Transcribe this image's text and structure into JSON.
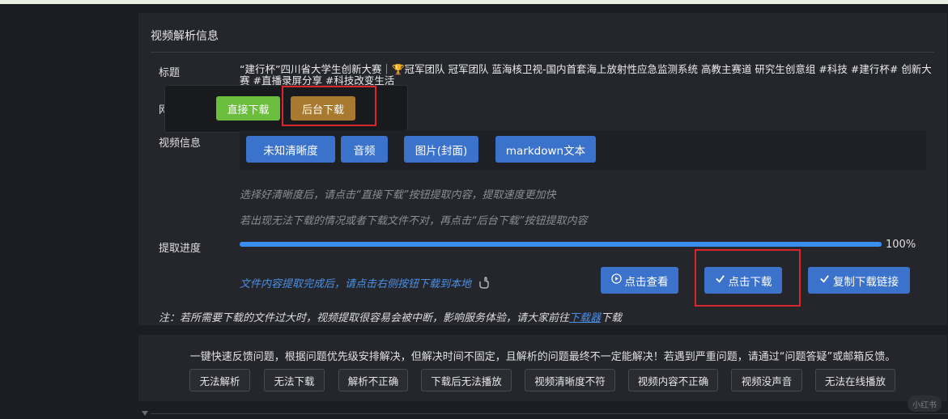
{
  "section_title": "视频解析信息",
  "fields": {
    "title_label": "标题",
    "title_value": "“建行杯”四川省大学生创新大赛｜🏆冠军团队 冠军团队 蓝海核卫视-国内首套海上放射性应急监测系统 高教主赛道 研究生创意组 #科技 #建行杯# 创新大赛 #直播录屏分享 #科技改变生活",
    "hidden_label_partial": "网",
    "video_info_label": "视频信息",
    "progress_label": "提取进度"
  },
  "popup": {
    "direct_download": "直接下载",
    "background_download": "后台下载"
  },
  "video_options": [
    "未知清晰度",
    "音频",
    "图片(封面)",
    "markdown文本"
  ],
  "hints": [
    "选择好清晰度后，请点击“直接下载”按钮提取内容，提取速度更加快",
    "若出现无法下载的情况或者下载文件不对，再点击“后台下载”按钮提取内容"
  ],
  "progress": {
    "value": 100,
    "text": "100%"
  },
  "complete_note": "文件内容提取完成后，请点击右侧按钮下载到本地",
  "actions": {
    "view": "点击查看",
    "download": "点击下载",
    "copy_link": "复制下载链接"
  },
  "notice": {
    "prefix": "注：若所需要下载的文件过大时，视频提取很容易会被中断，影响服务体验，请大家前往",
    "link": "下载器",
    "suffix": "下载"
  },
  "feedback": {
    "text": "一键快速反馈问题，根据问题优先级安排解决，但解决时间不固定，且解析的问题最终不一定能解决！若遇到严重问题，请通过“问题答疑”或邮箱反馈。",
    "buttons": [
      "无法解析",
      "无法下载",
      "解析不正确",
      "下载后无法播放",
      "视频清晰度不符",
      "视频内容不正确",
      "视频没声音",
      "无法在线播放"
    ]
  },
  "watermark": "小红书",
  "colors": {
    "accent_blue": "#3a72cc",
    "green": "#6bbd3e",
    "brown": "#a8792e",
    "highlight_red": "#d9262a"
  }
}
